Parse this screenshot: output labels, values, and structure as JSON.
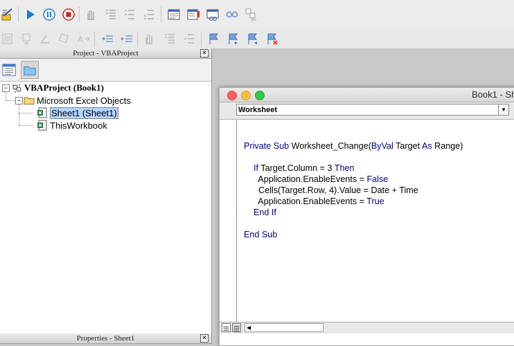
{
  "toolbar_top": {
    "buttons": [
      "design-mode",
      "run",
      "pause",
      "stop",
      "toggle-breakpoint",
      "step-into",
      "step-over",
      "step-out",
      "object-browser",
      "watch",
      "immediate",
      "locals"
    ]
  },
  "project_pane": {
    "title": "Project - VBAProject",
    "close_label": "✕",
    "tree": {
      "root": {
        "label": "VBAProject (Book1)",
        "expander": "−"
      },
      "folder": {
        "label": "Microsoft Excel Objects",
        "expander": "−"
      },
      "items": [
        {
          "label": "Sheet1 (Sheet1)",
          "selected": true
        },
        {
          "label": "ThisWorkbook",
          "selected": false
        }
      ]
    }
  },
  "properties_pane": {
    "title": "Properties - Sheet1",
    "close_label": "✕"
  },
  "code_window": {
    "title": "Book1 - Sh",
    "object_combo": {
      "value": "Worksheet",
      "arrow": "▼"
    },
    "code_lines": [
      [
        {
          "t": "Private Sub ",
          "k": true
        },
        {
          "t": "Worksheet_Change(",
          "k": false
        },
        {
          "t": "ByVal",
          "k": true
        },
        {
          "t": " Target ",
          "k": false
        },
        {
          "t": "As",
          "k": true
        },
        {
          "t": " Range)",
          "k": false
        }
      ],
      [],
      [
        {
          "t": "    If",
          "k": true
        },
        {
          "t": " Target.Column = 3 ",
          "k": false
        },
        {
          "t": "Then",
          "k": true
        }
      ],
      [
        {
          "t": "      Application.EnableEvents = ",
          "k": false
        },
        {
          "t": "False",
          "k": true
        }
      ],
      [
        {
          "t": "      Cells(Target.Row, 4).Value = Date + Time",
          "k": false
        }
      ],
      [
        {
          "t": "      Application.EnableEvents = ",
          "k": false
        },
        {
          "t": "True",
          "k": true
        }
      ],
      [
        {
          "t": "    End If",
          "k": true
        }
      ],
      [],
      [
        {
          "t": "End Sub",
          "k": true
        }
      ]
    ],
    "scroll_left_arrow": "◀"
  },
  "colors": {
    "keyword": "#000080",
    "selection": "#b5d5ff",
    "close_red": "#fc605c",
    "minimize_yellow": "#fdbc40",
    "zoom_green": "#34c84a"
  }
}
